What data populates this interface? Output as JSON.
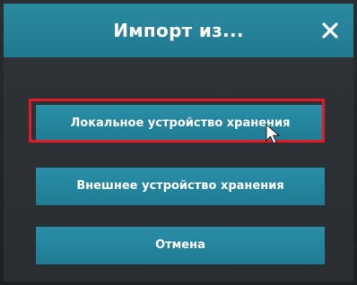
{
  "dialog": {
    "title": "Импорт из...",
    "close_icon": "close-icon"
  },
  "options": {
    "local_label": "Локальное устройство хранения",
    "external_label": "Внешнее устройство хранения",
    "cancel_label": "Отмена"
  },
  "colors": {
    "accent": "#2a8ea7",
    "highlight": "#e31b23",
    "background": "#2f3337"
  }
}
